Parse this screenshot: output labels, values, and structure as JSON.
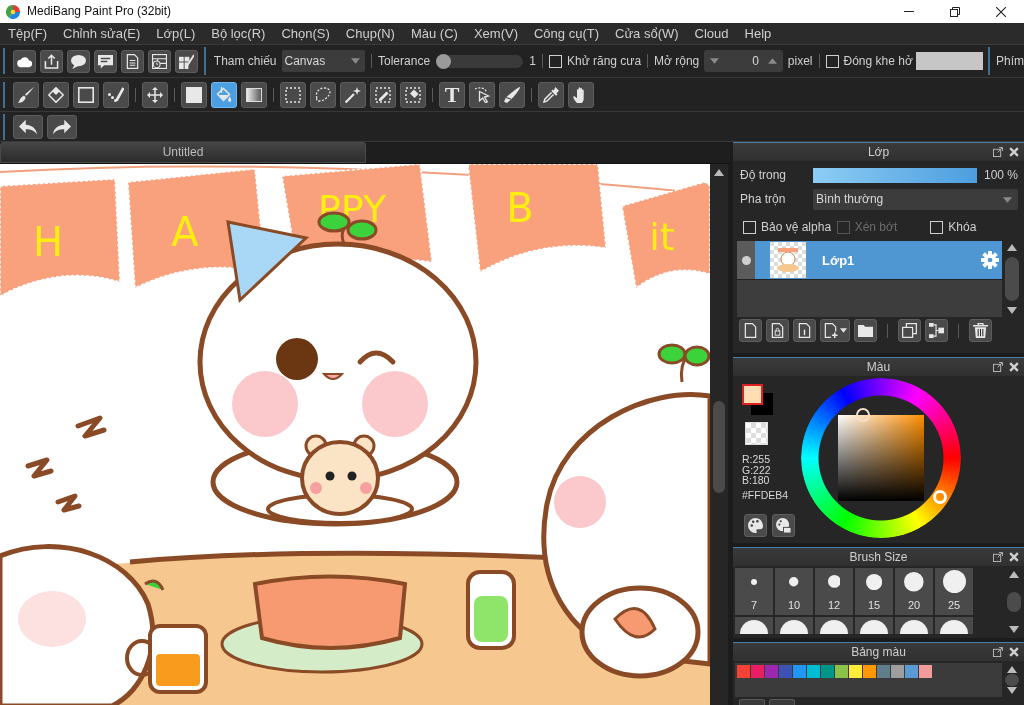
{
  "window": {
    "title": "MediBang Paint Pro (32bit)"
  },
  "menu": [
    "Tệp(F)",
    "Chỉnh sửa(E)",
    "Lớp(L)",
    "Bộ lọc(R)",
    "Chọn(S)",
    "Chụp(N)",
    "Màu (C)",
    "Xem(V)",
    "Công cụ(T)",
    "Cửa sổ(W)",
    "Cloud",
    "Help"
  ],
  "tool_options": {
    "reference": {
      "label": "Tham chiếu",
      "value": "Canvas"
    },
    "tolerance": {
      "label": "Tolerance",
      "level": 0,
      "reading": "1"
    },
    "antialias": {
      "label": "Khử răng cưa",
      "checked": false
    },
    "expand": {
      "label": "Mở rộng",
      "value": "0",
      "unit": "pixel"
    },
    "close_gap": {
      "label": "Đóng khe hở",
      "checked": false
    },
    "shortcuts": {
      "label": "Phím"
    }
  },
  "tools": [
    [
      {
        "selected": false
      },
      {
        "selected": false
      },
      {
        "selected": false
      },
      {
        "selected": false
      }
    ],
    [
      {
        "selected": false
      }
    ],
    [
      {
        "selected": false
      },
      {
        "selected": true
      },
      {
        "selected": false
      }
    ],
    [
      {
        "selected": false
      },
      {
        "selected": false
      },
      {
        "selected": false
      },
      {
        "selected": false
      },
      {
        "selected": false
      }
    ],
    [
      {
        "selected": false,
        "glyph": "T"
      },
      {
        "selected": false
      },
      {
        "selected": false
      }
    ],
    [
      {
        "selected": false
      },
      {
        "selected": false
      }
    ]
  ],
  "document_tab": {
    "title": "Untitled"
  },
  "canvas": {
    "banner_letters": [
      "H",
      "A",
      "PPY",
      "B",
      "it"
    ]
  },
  "layer_panel": {
    "title": "Lớp",
    "opacity": {
      "label": "Độ trong",
      "level": 1,
      "reading": "100 %"
    },
    "blend": {
      "label": "Pha trộn",
      "value": "Bình thường"
    },
    "options": [
      {
        "label": "Bảo vệ alpha",
        "checked": false,
        "disabled": false
      },
      {
        "label": "Xén bớt",
        "checked": false,
        "disabled": true
      },
      {
        "label": "Khóa",
        "checked": false,
        "disabled": false
      }
    ],
    "layers": [
      {
        "name": "Lớp1",
        "selected": true,
        "visible": true
      }
    ]
  },
  "color_panel": {
    "title": "Màu",
    "foreground": {
      "color": "#ffdeb4",
      "selected": true
    },
    "background": {
      "color": "#000000",
      "selected": false
    },
    "rgb": [
      "R:255",
      "G:222",
      "B:180"
    ],
    "hex": "#FFDEB4"
  },
  "brush_size_panel": {
    "title": "Brush Size",
    "sizes": [
      {
        "kind": "full",
        "label": "7"
      },
      {
        "kind": "full",
        "label": "10"
      },
      {
        "kind": "full",
        "label": "12"
      },
      {
        "kind": "full",
        "label": "15"
      },
      {
        "kind": "full",
        "label": "20"
      },
      {
        "kind": "full",
        "label": "25"
      },
      {
        "kind": "partial"
      },
      {
        "kind": "partial"
      },
      {
        "kind": "partial"
      },
      {
        "kind": "partial"
      },
      {
        "kind": "partial"
      },
      {
        "kind": "partial"
      }
    ]
  },
  "palette_panel": {
    "title": "Bảng màu",
    "swatches": [
      {
        "color": "#f44336"
      },
      {
        "color": "#e91e63"
      },
      {
        "color": "#9c27b0"
      },
      {
        "color": "#3f51b5"
      },
      {
        "color": "#2196f3"
      },
      {
        "color": "#00bcd4"
      },
      {
        "color": "#009688"
      },
      {
        "color": "#8bc34a"
      },
      {
        "color": "#ffeb3b"
      },
      {
        "color": "#ff9800"
      },
      {
        "color": "#607d8b"
      },
      {
        "color": "#9e9e9e"
      },
      {
        "color": "#5b9bd5"
      },
      {
        "color": "#f29b9b"
      }
    ]
  }
}
